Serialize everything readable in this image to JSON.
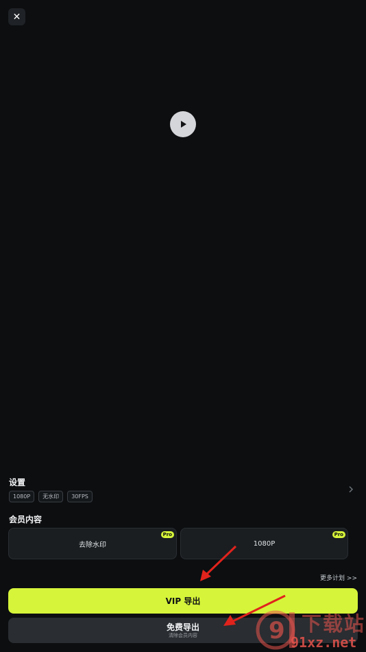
{
  "header": {
    "close_icon_glyph": "✕"
  },
  "player": {
    "play_icon": "play-icon"
  },
  "settings": {
    "title": "设置",
    "tags": [
      "1080P",
      "无水印",
      "30FPS"
    ],
    "chevron_icon": "chevron-right-icon"
  },
  "member": {
    "title": "会员内容",
    "cards": [
      {
        "label": "去除水印",
        "badge": "Pro"
      },
      {
        "label": "1080P",
        "badge": "Pro"
      }
    ]
  },
  "more_plans": "更多计划 >>",
  "vip_button": {
    "label": "VIP 导出"
  },
  "free_button": {
    "label": "免费导出",
    "sub": "清除会员内容"
  },
  "watermark": {
    "brand": "下载站",
    "url": "91xz.net",
    "logo_text": "9"
  },
  "colors": {
    "background": "#0c0e10",
    "accent": "#d5f43a",
    "card": "#1b1e21",
    "annotation_arrow": "#e0231c",
    "watermark": "#e7544c"
  }
}
